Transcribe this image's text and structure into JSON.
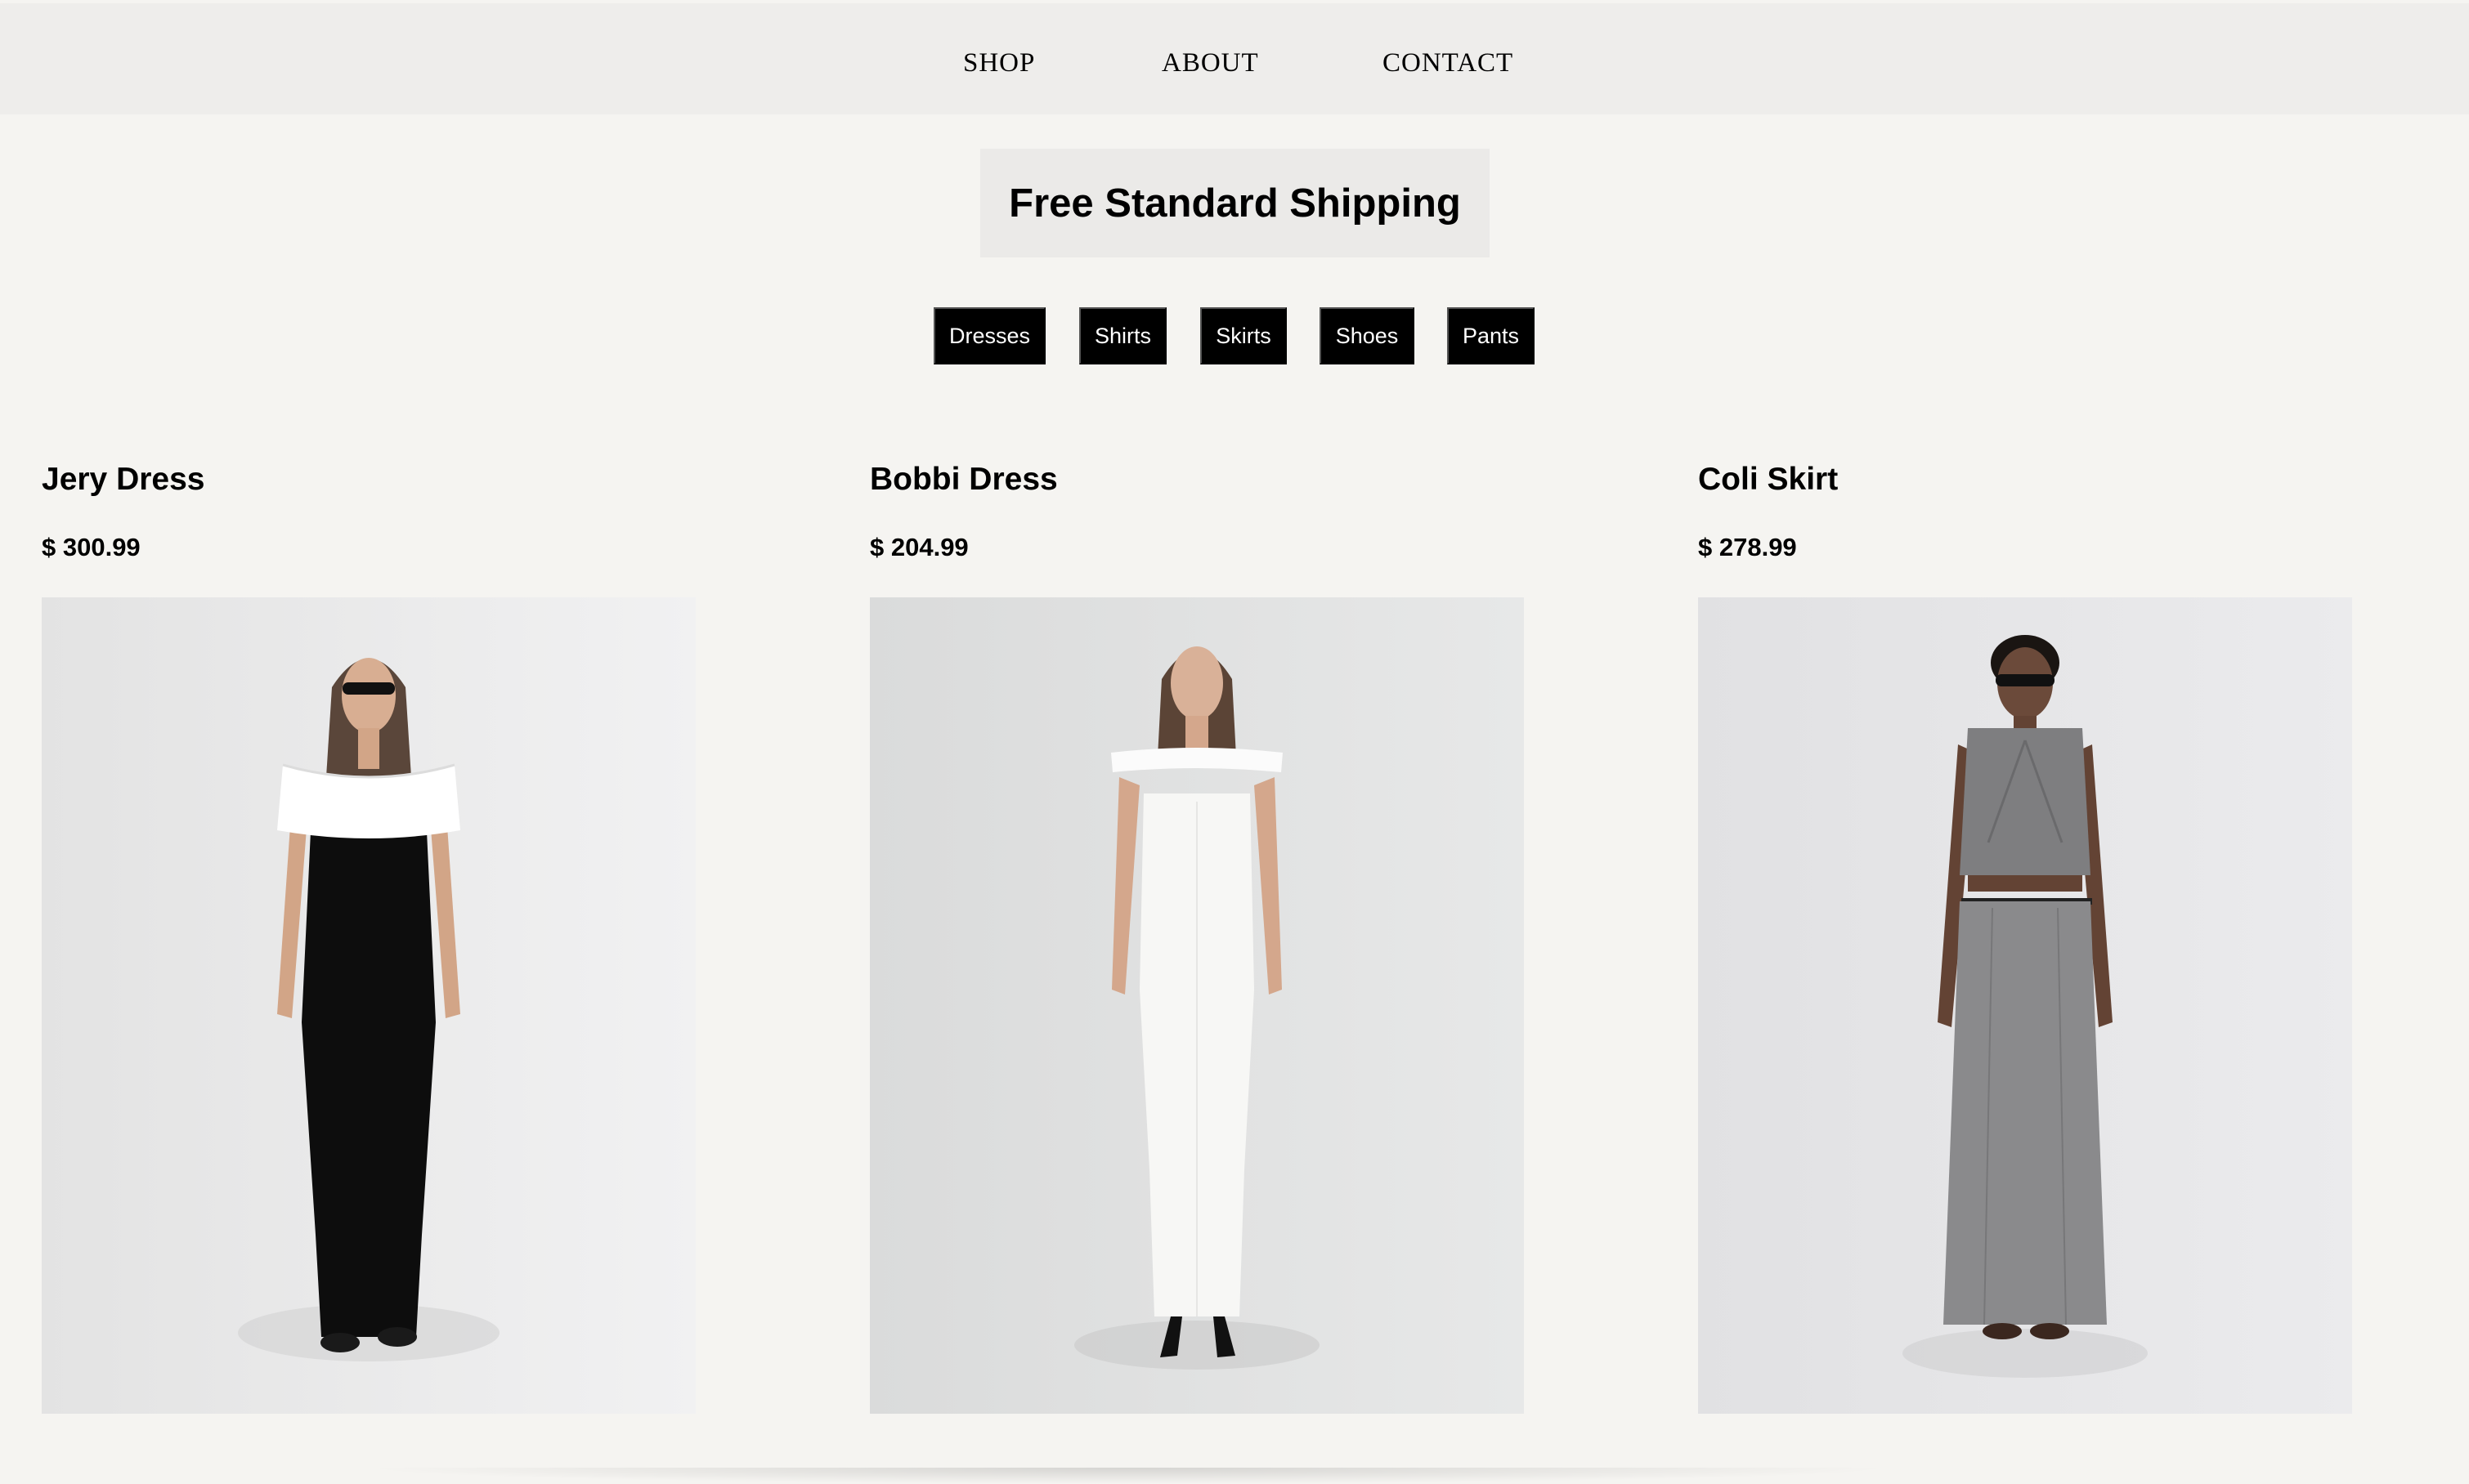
{
  "nav": {
    "items": [
      "SHOP",
      "ABOUT",
      "CONTACT"
    ]
  },
  "banner": {
    "text": "Free Standard Shipping"
  },
  "categories": [
    "Dresses",
    "Shirts",
    "Skirts",
    "Shoes",
    "Pants"
  ],
  "products": [
    {
      "title": "Jery Dress",
      "price": "$ 300.99",
      "image_icon": "model-black-offshoulder-dress-photo"
    },
    {
      "title": "Bobbi Dress",
      "price": "$ 204.99",
      "image_icon": "model-white-strapless-dress-photo"
    },
    {
      "title": "Coli Skirt",
      "price": "$ 278.99",
      "image_icon": "model-grey-vest-maxi-skirt-photo"
    }
  ],
  "colors": {
    "page_background": "#f5f4f1",
    "nav_background": "#eeedeb",
    "banner_background": "#ebeae8",
    "category_button": "#000000",
    "category_text": "#ffffff"
  }
}
